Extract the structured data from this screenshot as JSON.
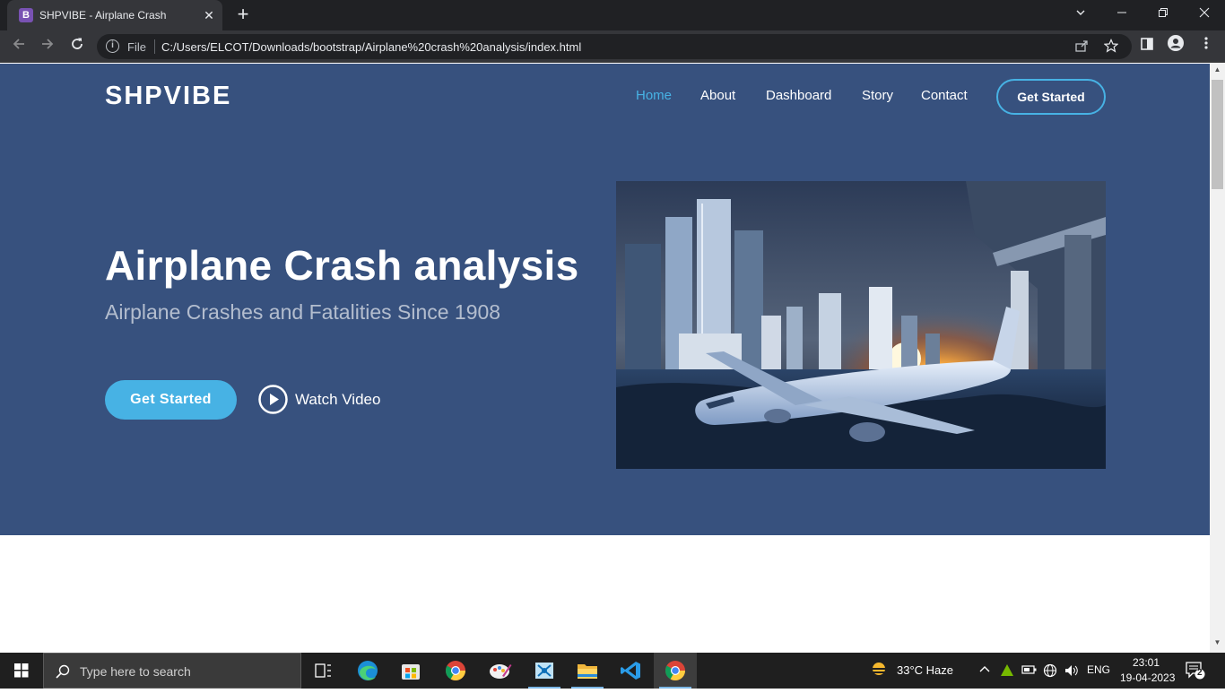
{
  "browser": {
    "tab_title": "SHPVIBE - Airplane Crash",
    "tab_favicon_letter": "B",
    "new_tab": "+",
    "tab_close": "✕",
    "address_scheme_label": "File",
    "url": "C:/Users/ELCOT/Downloads/bootstrap/Airplane%20crash%20analysis/index.html"
  },
  "site": {
    "logo": "SHPVIBE",
    "nav": [
      {
        "label": "Home",
        "active": true
      },
      {
        "label": "About",
        "active": false
      },
      {
        "label": "Dashboard",
        "active": false
      },
      {
        "label": "Story",
        "active": false
      },
      {
        "label": "Contact",
        "active": false
      }
    ],
    "nav_cta": "Get Started",
    "hero": {
      "title": "Airplane Crash analysis",
      "subtitle": "Airplane Crashes and Fatalities Since 1908",
      "primary_button": "Get Started",
      "video_link": "Watch Video"
    }
  },
  "taskbar": {
    "search_placeholder": "Type here to search",
    "weather": "33°C  Haze",
    "language": "ENG",
    "time": "23:01",
    "date": "19-04-2023",
    "notifications": "2"
  },
  "colors": {
    "hero_bg": "#37517e",
    "accent": "#47b2e4",
    "chrome_dark": "#202124",
    "chrome_toolbar": "#35363a"
  }
}
